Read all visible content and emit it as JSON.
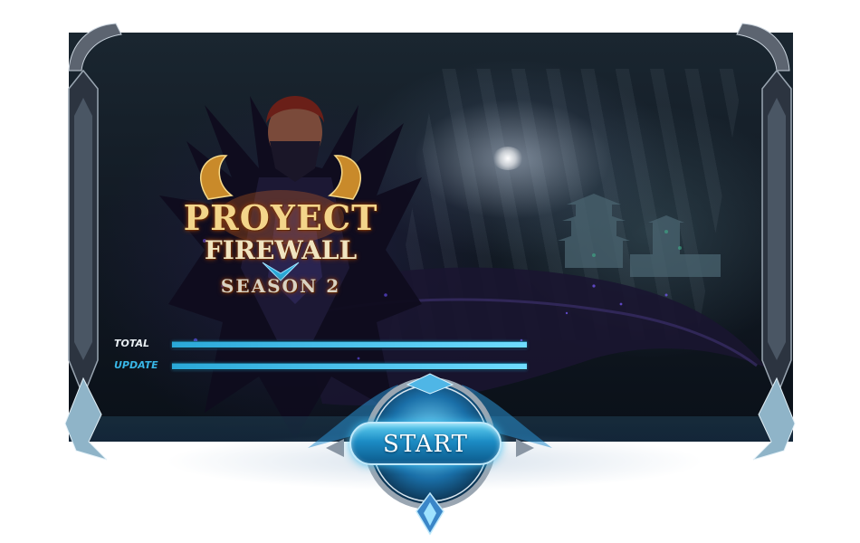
{
  "logo": {
    "line1": "PROYECT",
    "line2": "FIREWALL",
    "line3": "SEASON 2"
  },
  "progress": {
    "total_label": "TOTAL",
    "update_label": "UPDATE",
    "total_value": 1.0,
    "update_value": 1.0
  },
  "start_button": {
    "label": "START"
  },
  "colors": {
    "accent": "#38b6e6",
    "logo_gold": "#f3d58a",
    "button_blue": "#1c8cc4"
  }
}
